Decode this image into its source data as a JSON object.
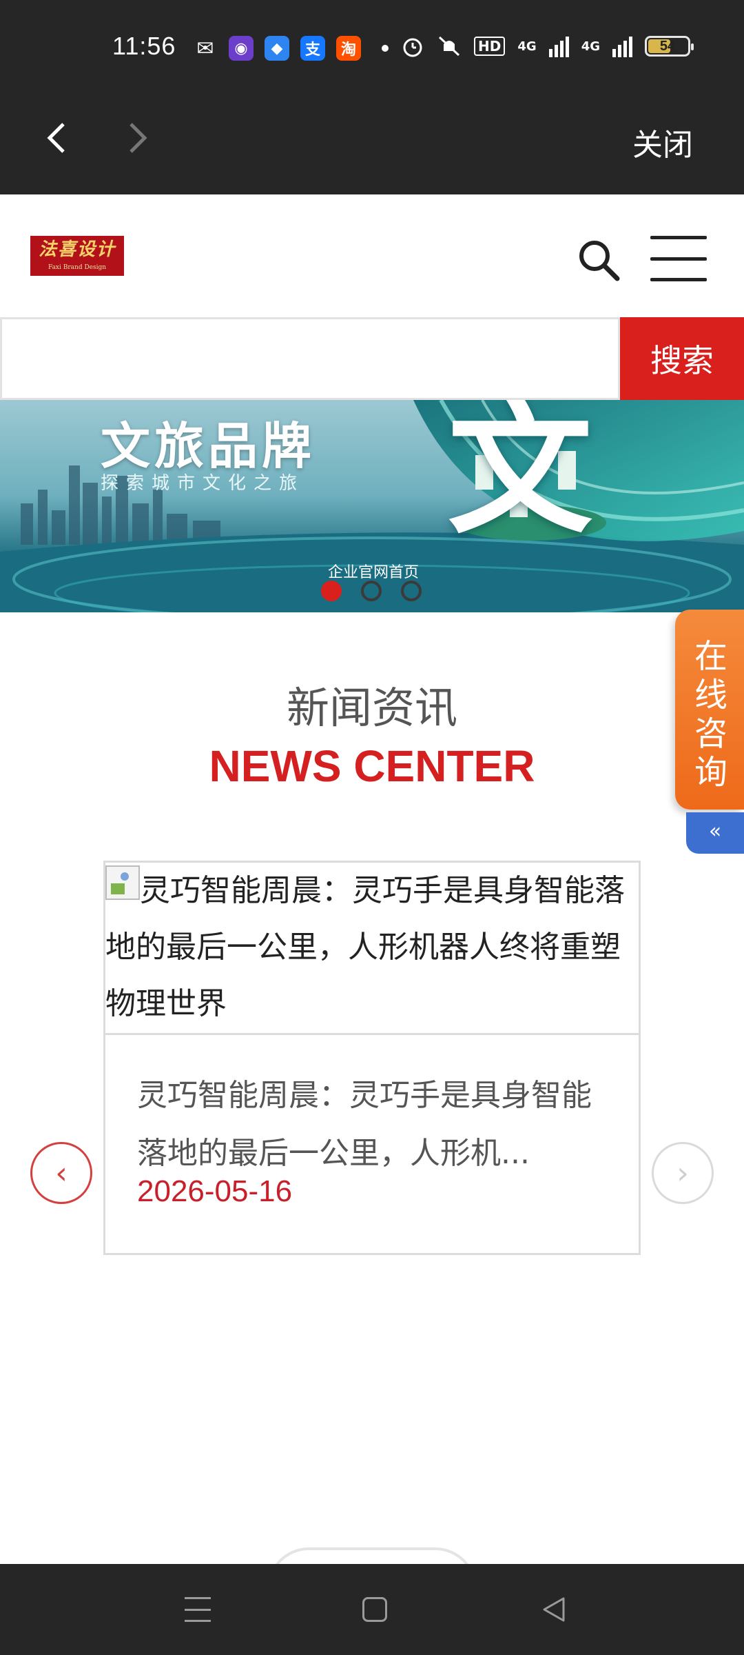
{
  "status_bar": {
    "time": "11:56",
    "apps": [
      {
        "icon": "wechat-icon",
        "glyph": "✉",
        "color": "#262626"
      },
      {
        "icon": "app-icon-purple",
        "glyph": "◉",
        "color": "#6b3fc9"
      },
      {
        "icon": "browser-icon",
        "glyph": "◆",
        "color": "#2e84f0"
      },
      {
        "icon": "alipay-icon",
        "glyph": "支",
        "color": "#1677ff"
      },
      {
        "icon": "taobao-icon",
        "glyph": "淘",
        "color": "#ff5000"
      }
    ],
    "network": "4G",
    "hd_label": "HD",
    "battery": "54"
  },
  "browser": {
    "close_label": "关闭"
  },
  "header": {
    "logo_main": "法喜设计",
    "logo_sub": "Faxi Brand Design"
  },
  "search": {
    "placeholder": "",
    "button_label": "搜索"
  },
  "banner": {
    "title": "文旅品牌",
    "subtitle": "探索城市文化之旅",
    "big_char": "文",
    "caption": "企业官网首页",
    "slide_count": 3,
    "active_slide": 1
  },
  "section": {
    "title_cn": "新闻资讯",
    "title_en": "NEWS CENTER"
  },
  "consult": {
    "label": "在线咨询",
    "toggle": "«"
  },
  "news": {
    "image_alt": "灵巧智能周晨：灵巧手是具身智能落地的最后一公里，人形机器人终将重塑物理世界",
    "title": "灵巧智能周晨：灵巧手是具身智能落地的最后一公里，人形机...",
    "date": "2026-05-16",
    "prev": "‹",
    "next": "›"
  }
}
